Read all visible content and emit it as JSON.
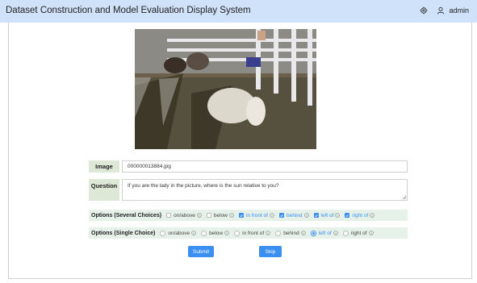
{
  "header": {
    "title": "Dataset Construction and Model Evaluation Display System",
    "user": "admin"
  },
  "icons": {
    "settings": "gear-icon",
    "user": "user-icon",
    "info": "info-circle-icon",
    "check": "check-icon"
  },
  "form": {
    "image_label": "Image",
    "image_value": "000000013884.jpg",
    "question_label": "Question",
    "question_value": "If you are the lady in the picture, where is the sun relative to you?",
    "options_multi_label": "Options (Several Choices)",
    "options_multi": [
      {
        "label": "on/above",
        "checked": false
      },
      {
        "label": "below",
        "checked": false
      },
      {
        "label": "in front of",
        "checked": true
      },
      {
        "label": "behind",
        "checked": true
      },
      {
        "label": "left of",
        "checked": true
      },
      {
        "label": "right of",
        "checked": true
      }
    ],
    "options_single_label": "Options (Single Choice)",
    "options_single": [
      {
        "label": "on/above",
        "selected": false
      },
      {
        "label": "below",
        "selected": false
      },
      {
        "label": "in front of",
        "selected": false
      },
      {
        "label": "behind",
        "selected": false
      },
      {
        "label": "left of",
        "selected": true
      },
      {
        "label": "right of",
        "selected": false
      }
    ]
  },
  "buttons": {
    "submit": "Submit",
    "skip": "Skip"
  },
  "colors": {
    "header_bg": "#cfe2fa",
    "accent": "#3b8ef2",
    "label_bg": "#dde8d7",
    "option_bg": "#e6f1ea"
  }
}
